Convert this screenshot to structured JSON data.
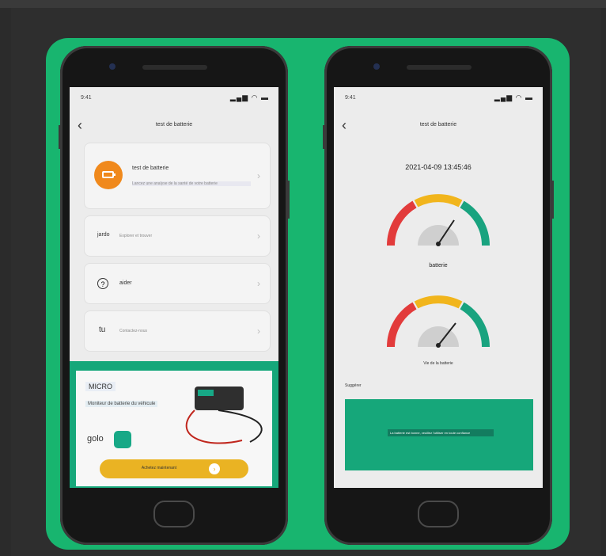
{
  "left_phone": {
    "status_time": "9:41",
    "title": "test de batterie",
    "cards": [
      {
        "label": "test de batterie",
        "sub": "Lancez une analyse de la santé de votre batterie"
      },
      {
        "label": "jardo",
        "sub": "Explorer et trouver"
      },
      {
        "label": "aider",
        "sub": ""
      },
      {
        "label": "tu",
        "sub": "Contactez-nous"
      }
    ],
    "promo": {
      "heading": "MICRO",
      "subtitle": "Moniteur de batterie du véhicule",
      "brand": "golo",
      "button_label": "Achetez maintenant"
    }
  },
  "right_phone": {
    "status_time": "9:41",
    "title": "test de batterie",
    "datetime": "2021-04-09 13:45:46",
    "gauge1_label": "batterie",
    "gauge2_label": "Vie de la batterie",
    "suggest_label": "Suggérer",
    "result_text": "La batterie est bonne, veuillez l'utiliser en toute confiance"
  }
}
